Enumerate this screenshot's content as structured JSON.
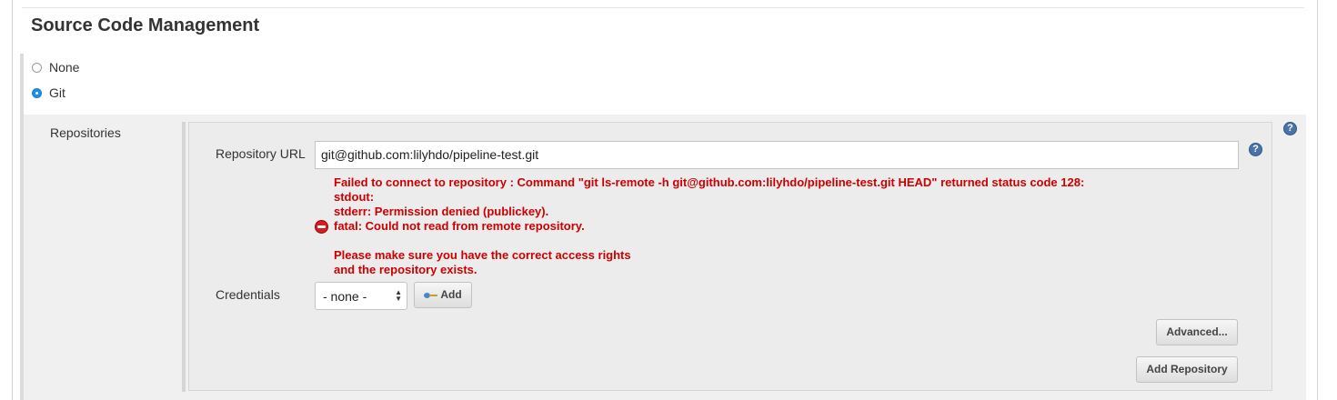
{
  "section": {
    "title": "Source Code Management"
  },
  "scm_options": [
    {
      "label": "None",
      "checked": false
    },
    {
      "label": "Git",
      "checked": true
    }
  ],
  "repositories": {
    "label": "Repositories",
    "url_label": "Repository URL",
    "url_value": "git@github.com:lilyhdo/pipeline-test.git",
    "error": {
      "icon": "error-icon",
      "lines": [
        "Failed to connect to repository : Command \"git ls-remote -h git@github.com:lilyhdo/pipeline-test.git HEAD\" returned status code 128:",
        "stdout:",
        "stderr: Permission denied (publickey).",
        "fatal: Could not read from remote repository.",
        "Please make sure you have the correct access rights",
        "and the repository exists."
      ],
      "color": "#cc0000"
    },
    "credentials_label": "Credentials",
    "credentials_value": "- none -",
    "add_button": "Add",
    "advanced_button": "Advanced...",
    "add_repository_button": "Add Repository"
  },
  "icons": {
    "help": "help-icon",
    "key": "key-icon"
  },
  "colors": {
    "accent": "#1d8fe8",
    "help": "#4a74a8"
  }
}
